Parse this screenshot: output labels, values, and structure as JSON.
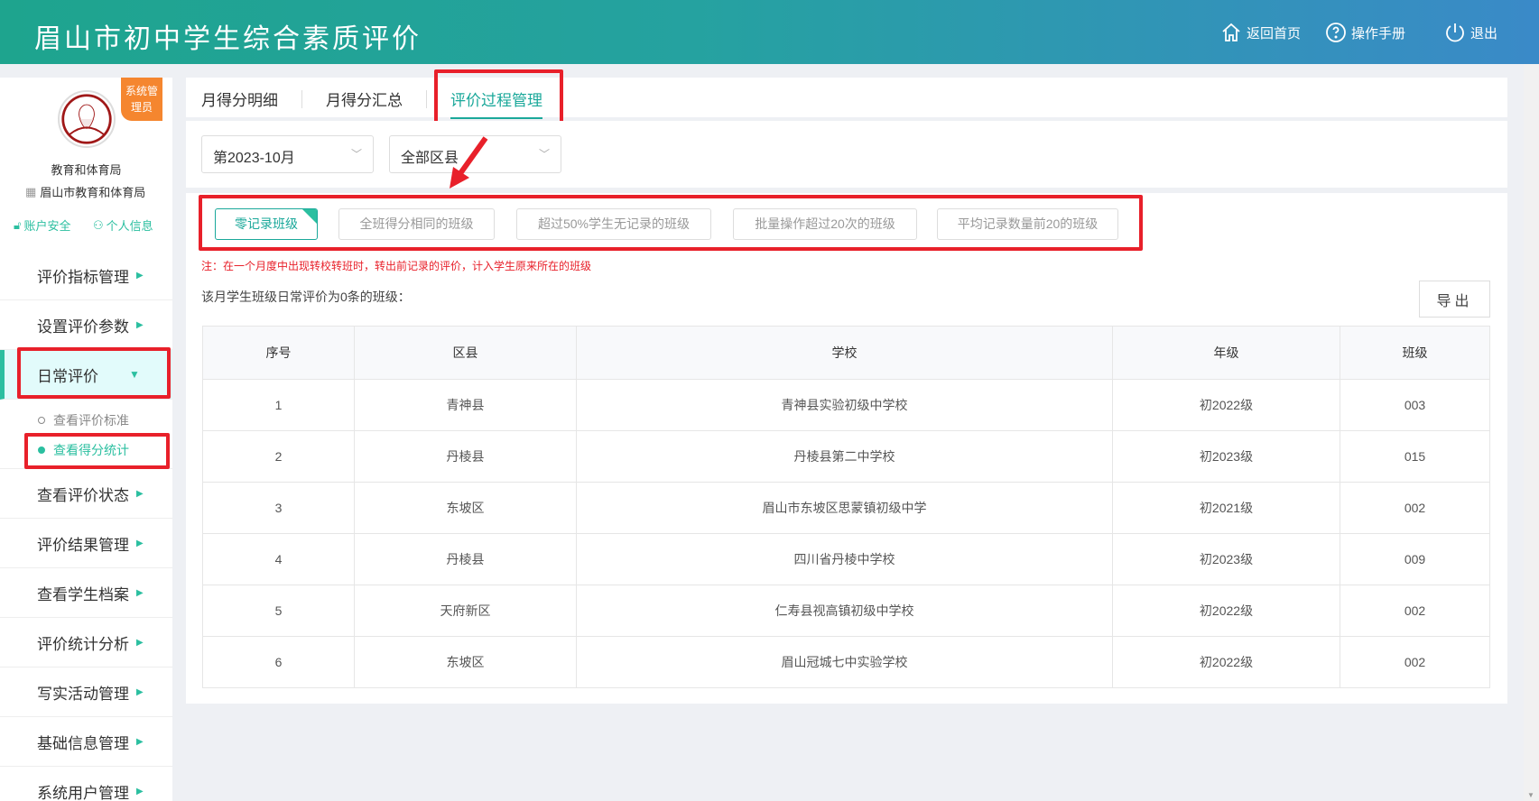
{
  "header": {
    "title": "眉山市初中学生综合素质评价",
    "links": [
      {
        "icon": "home-icon",
        "label": "返回首页"
      },
      {
        "icon": "help-icon",
        "label": "操作手册"
      },
      {
        "icon": "power-icon",
        "label": "退出"
      }
    ]
  },
  "profile": {
    "badge": "系统管理员",
    "name": "教育和体育局",
    "org": "眉山市教育和体育局",
    "account_security": "账户安全",
    "personal_info": "个人信息"
  },
  "menu": {
    "items": [
      "评价指标管理",
      "设置评价参数",
      "日常评价",
      "查看评价状态",
      "评价结果管理",
      "查看学生档案",
      "评价统计分析",
      "写实活动管理",
      "基础信息管理",
      "系统用户管理"
    ],
    "sub": [
      "查看评价标准",
      "查看得分统计"
    ]
  },
  "tabs": [
    "月得分明细",
    "月得分汇总",
    "评价过程管理"
  ],
  "filters": {
    "month": "第2023-10月",
    "district": "全部区县"
  },
  "filter_buttons": [
    "零记录班级",
    "全班得分相同的班级",
    "超过50%学生无记录的班级",
    "批量操作超过20次的班级",
    "平均记录数量前20的班级"
  ],
  "note": "注：在一个月度中出现转校转班时，转出前记录的评价，计入学生原来所在的班级",
  "result_label": "该月学生班级日常评价为0条的班级：",
  "export_label": "导出",
  "table": {
    "headers": [
      "序号",
      "区县",
      "学校",
      "年级",
      "班级"
    ],
    "rows": [
      [
        "1",
        "青神县",
        "青神县实验初级中学校",
        "初2022级",
        "003"
      ],
      [
        "2",
        "丹棱县",
        "丹棱县第二中学校",
        "初2023级",
        "015"
      ],
      [
        "3",
        "东坡区",
        "眉山市东坡区思蒙镇初级中学",
        "初2021级",
        "002"
      ],
      [
        "4",
        "丹棱县",
        "四川省丹棱中学校",
        "初2023级",
        "009"
      ],
      [
        "5",
        "天府新区",
        "仁寿县视高镇初级中学校",
        "初2022级",
        "002"
      ],
      [
        "6",
        "东坡区",
        "眉山冠城七中实验学校",
        "初2022级",
        "002"
      ]
    ]
  }
}
